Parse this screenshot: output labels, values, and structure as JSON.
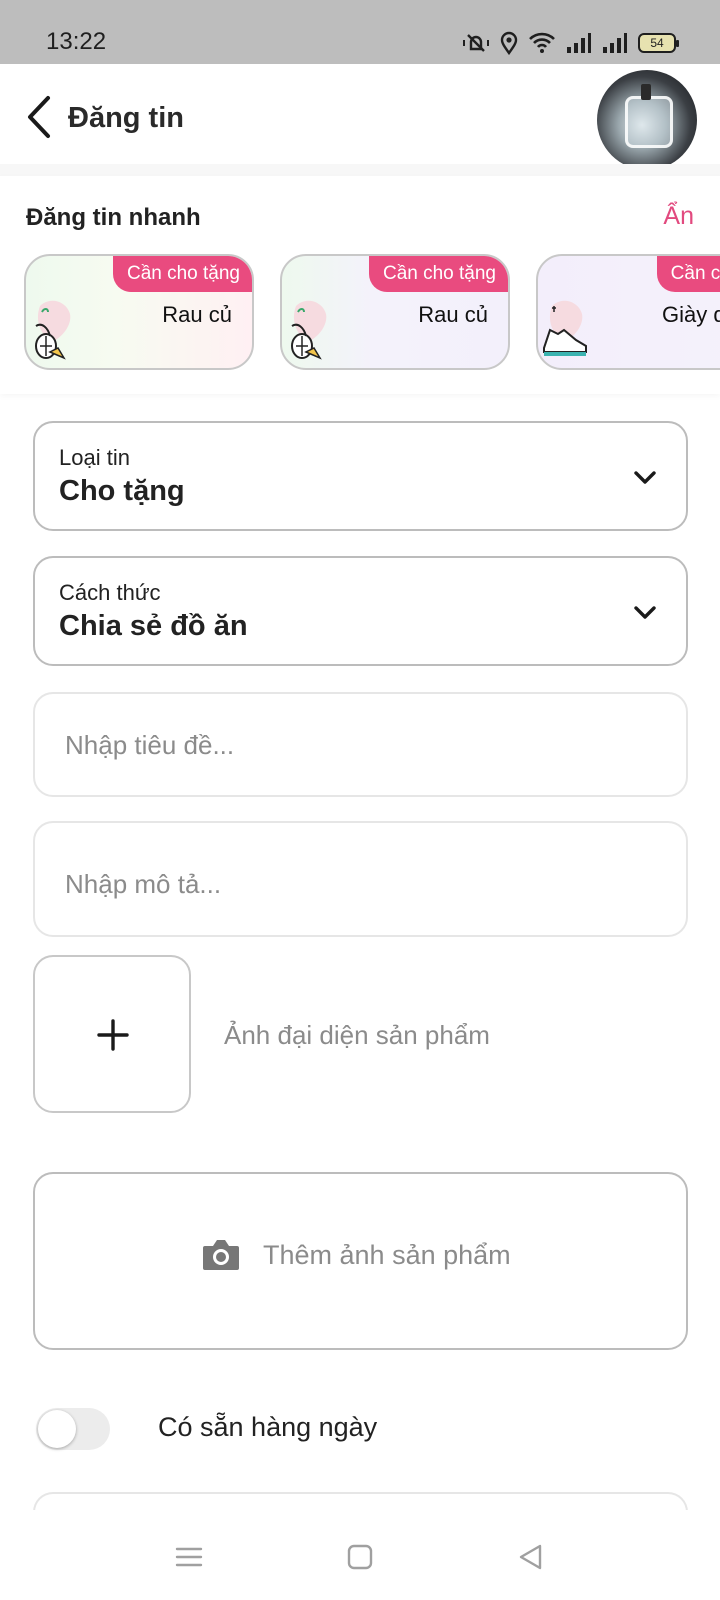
{
  "status_bar": {
    "time": "13:22",
    "battery": "54",
    "icons": [
      "mute-vibrate-icon",
      "location-icon",
      "wifi-icon",
      "signal-icon",
      "signal-icon",
      "battery-icon"
    ]
  },
  "header": {
    "title": "Đăng tin",
    "back_icon": "chevron-left-icon"
  },
  "quick_post": {
    "title": "Đăng tin nhanh",
    "hide_label": "Ẩn",
    "accent": "#e94b7f",
    "cards": [
      {
        "badge": "Cần cho tặng",
        "label": "Rau củ",
        "icon": "vegetables-icon"
      },
      {
        "badge": "Cần cho tặng",
        "label": "Rau củ",
        "icon": "vegetables-icon"
      },
      {
        "badge": "Cần cho t",
        "label": "Giày d",
        "icon": "shoe-icon"
      }
    ]
  },
  "form": {
    "post_type": {
      "label": "Loại tin",
      "value": "Cho tặng"
    },
    "method": {
      "label": "Cách thức",
      "value": "Chia sẻ đồ ăn"
    },
    "title_input": {
      "placeholder": "Nhập tiêu đề..."
    },
    "description_input": {
      "placeholder": "Nhập mô tả..."
    },
    "cover_photo_label": "Ảnh đại diện sản phẩm",
    "add_photos_label": "Thêm ảnh sản phẩm",
    "daily_toggle": {
      "label": "Có sẵn hàng ngày",
      "on": false
    }
  }
}
